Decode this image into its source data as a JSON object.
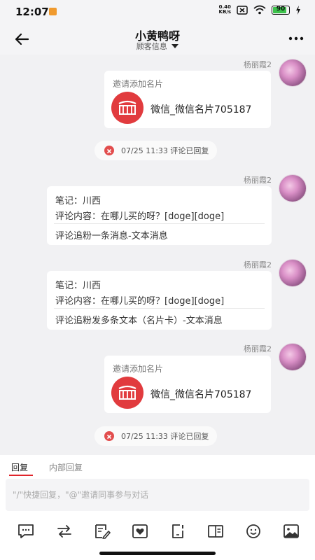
{
  "status_bar": {
    "time": "12:07",
    "speed_value": "0.40",
    "speed_unit": "KB/s",
    "battery": "90",
    "battery_level": 0.9
  },
  "header": {
    "title": "小黄鸭呀",
    "subtitle": "顾客信息"
  },
  "messages": [
    {
      "sender": "杨丽霞2",
      "type": "card",
      "label": "邀请添加名片",
      "name": "微信_微信名片705187"
    },
    {
      "type": "system",
      "text": "07/25 11:33 评论已回复"
    },
    {
      "sender": "杨丽霞2",
      "type": "note",
      "note_line": "笔记：川西",
      "comment_line": "评论内容：在哪儿买的呀？[doge][doge]",
      "action_line": "评论追粉一条消息-文本消息"
    },
    {
      "sender": "杨丽霞2",
      "type": "note",
      "note_line": "笔记：川西",
      "comment_line": "评论内容：在哪儿买的呀？[doge][doge]",
      "action_line": "评论追粉发多条文本（名片卡）-文本消息"
    },
    {
      "sender": "杨丽霞2",
      "type": "card",
      "label": "邀请添加名片",
      "name": "微信_微信名片705187"
    },
    {
      "type": "system",
      "text": "07/25 11:33 评论已回复"
    }
  ],
  "reply": {
    "tabs": [
      "回复",
      "内部回复"
    ],
    "placeholder": "\"/\"快捷回复，\"@\"邀请同事参与对话"
  },
  "toolbar_icons": [
    "chat-bubble-icon",
    "transfer-icon",
    "edit-note-icon",
    "heart-card-icon",
    "phone-info-icon",
    "book-icon",
    "emoji-icon",
    "image-icon"
  ],
  "colors": {
    "accent": "#e0242b",
    "card_logo": "#e13b3e",
    "system_icon": "#e24d4d",
    "battery": "#3cc24b"
  }
}
